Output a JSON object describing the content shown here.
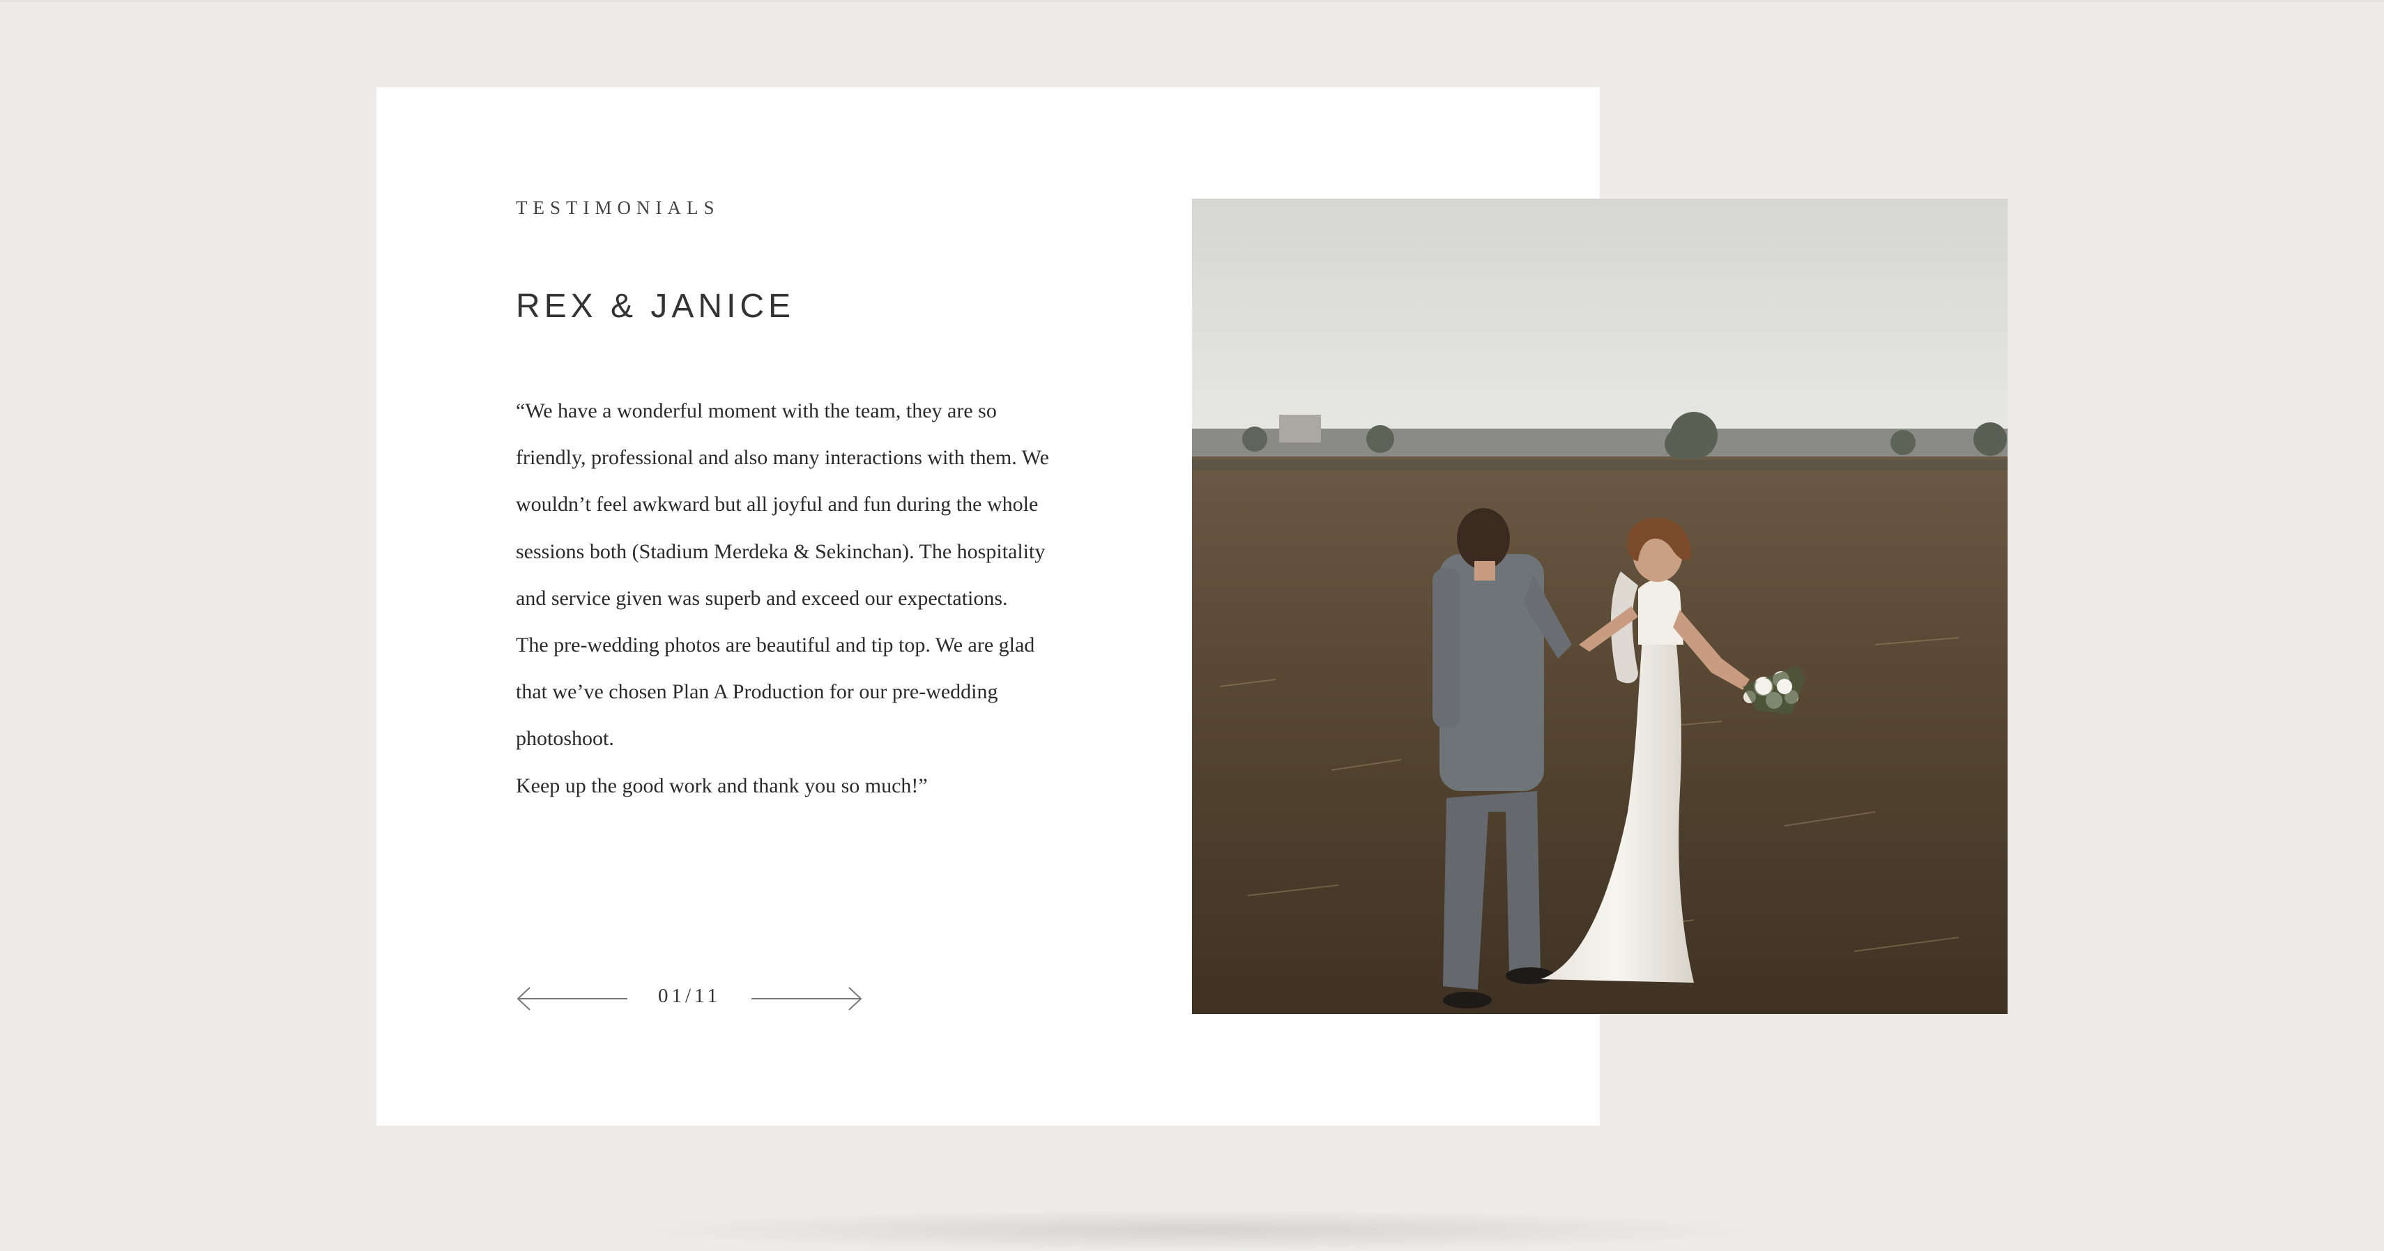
{
  "testimonial": {
    "eyebrow": "TESTIMONIALS",
    "name": "REX & JANICE",
    "quote_paragraphs": [
      "“We have a wonderful moment with the team, they are so friendly, professional and also many interactions with them. We wouldn’t feel awkward but all joyful and fun during the whole sessions both (Stadium Merdeka & Sekinchan). The hospitality and service given was superb and exceed our expectations.",
      "The pre-wedding photos are beautiful and tip top. We are glad that we’ve chosen Plan A Production for our pre-wedding photoshoot.",
      "Keep up the good work and thank you so much!”"
    ]
  },
  "pager": {
    "counter": "01/11",
    "prev_icon": "arrow-left-icon",
    "next_icon": "arrow-right-icon"
  },
  "colors": {
    "page_background": "#edece8",
    "card_background": "#ffffff",
    "text": "#2b2b2b"
  }
}
